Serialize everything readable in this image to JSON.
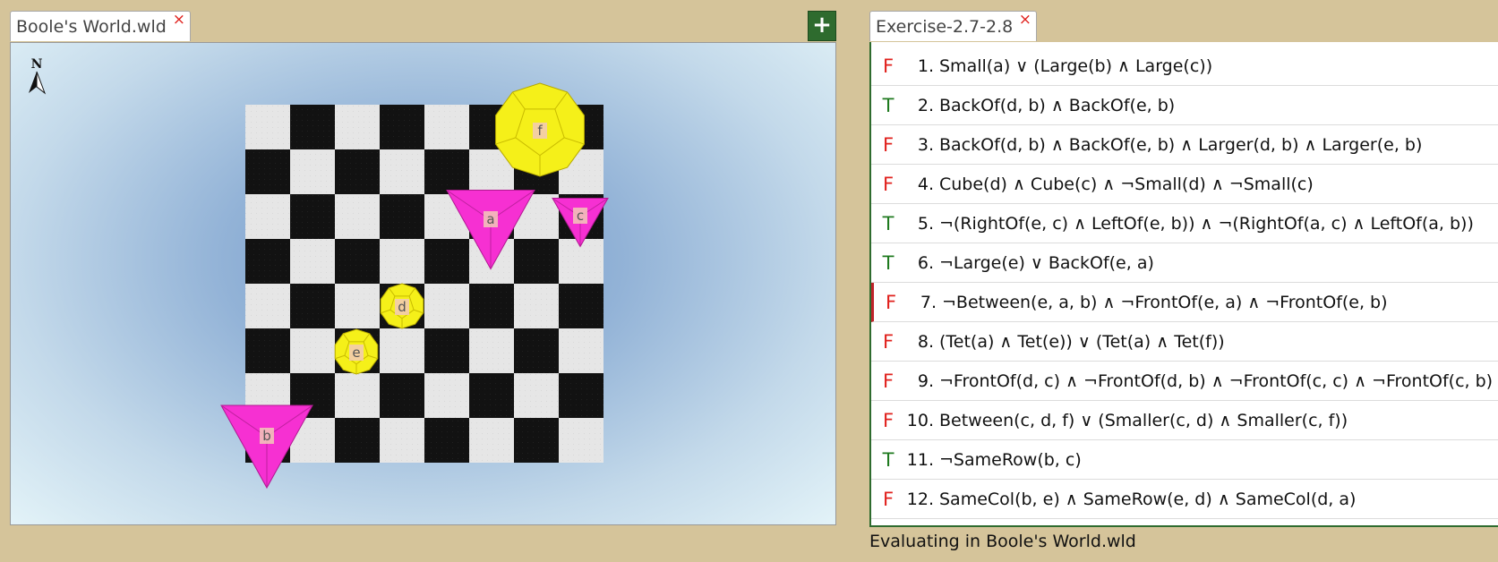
{
  "tabs": {
    "world": {
      "label": "Boole's World.wld",
      "close": "×"
    },
    "sentences": {
      "label": "Exercise-2.7-2.8",
      "close": "×"
    },
    "add_button": "+"
  },
  "world": {
    "compass_label": "N",
    "colors": {
      "dark_square": "#121212",
      "light_square": "#e6e6e6",
      "tet": "#f630d2",
      "dodec": "#f5f019",
      "label_bg": "#f2c9b8"
    },
    "objects": [
      {
        "name": "f",
        "shape": "dodecahedron",
        "size": "large"
      },
      {
        "name": "a",
        "shape": "tetrahedron",
        "size": "medium"
      },
      {
        "name": "c",
        "shape": "tetrahedron",
        "size": "small"
      },
      {
        "name": "d",
        "shape": "dodecahedron",
        "size": "small"
      },
      {
        "name": "e",
        "shape": "dodecahedron",
        "size": "small"
      },
      {
        "name": "b",
        "shape": "tetrahedron",
        "size": "large"
      }
    ]
  },
  "sentences": [
    {
      "value": "F",
      "num": "1.",
      "text": "Small(a) ∨ (Large(b) ∧ Large(c))"
    },
    {
      "value": "T",
      "num": "2.",
      "text": "BackOf(d, b) ∧ BackOf(e, b)"
    },
    {
      "value": "F",
      "num": "3.",
      "text": "BackOf(d, b) ∧ BackOf(e, b) ∧ Larger(d, b) ∧ Larger(e, b)"
    },
    {
      "value": "F",
      "num": "4.",
      "text": "Cube(d) ∧ Cube(c) ∧ ¬Small(d) ∧ ¬Small(c)"
    },
    {
      "value": "T",
      "num": "5.",
      "text": "¬(RightOf(e, c) ∧ LeftOf(e, b)) ∧ ¬(RightOf(a, c) ∧ LeftOf(a, b))"
    },
    {
      "value": "T",
      "num": "6.",
      "text": "¬Large(e) ∨ BackOf(e, a)"
    },
    {
      "value": "F",
      "num": "7.",
      "text": "¬Between(e, a, b) ∧ ¬FrontOf(e, a) ∧ ¬FrontOf(e, b)"
    },
    {
      "value": "F",
      "num": "8.",
      "text": "(Tet(a) ∧ Tet(e)) ∨ (Tet(a) ∧ Tet(f))"
    },
    {
      "value": "F",
      "num": "9.",
      "text": "¬FrontOf(d, c) ∧ ¬FrontOf(d, b) ∧ ¬FrontOf(c, c) ∧ ¬FrontOf(c, b)"
    },
    {
      "value": "F",
      "num": "10.",
      "text": "Between(c, d, f) ∨ (Smaller(c, d) ∧ Smaller(c, f))"
    },
    {
      "value": "T",
      "num": "11.",
      "text": "¬SameRow(b, c)"
    },
    {
      "value": "F",
      "num": "12.",
      "text": "SameCol(b, e) ∧ SameRow(e, d) ∧ SameCol(d, a)"
    }
  ],
  "selected_sentence": 6,
  "status": "Evaluating in Boole's World.wld"
}
